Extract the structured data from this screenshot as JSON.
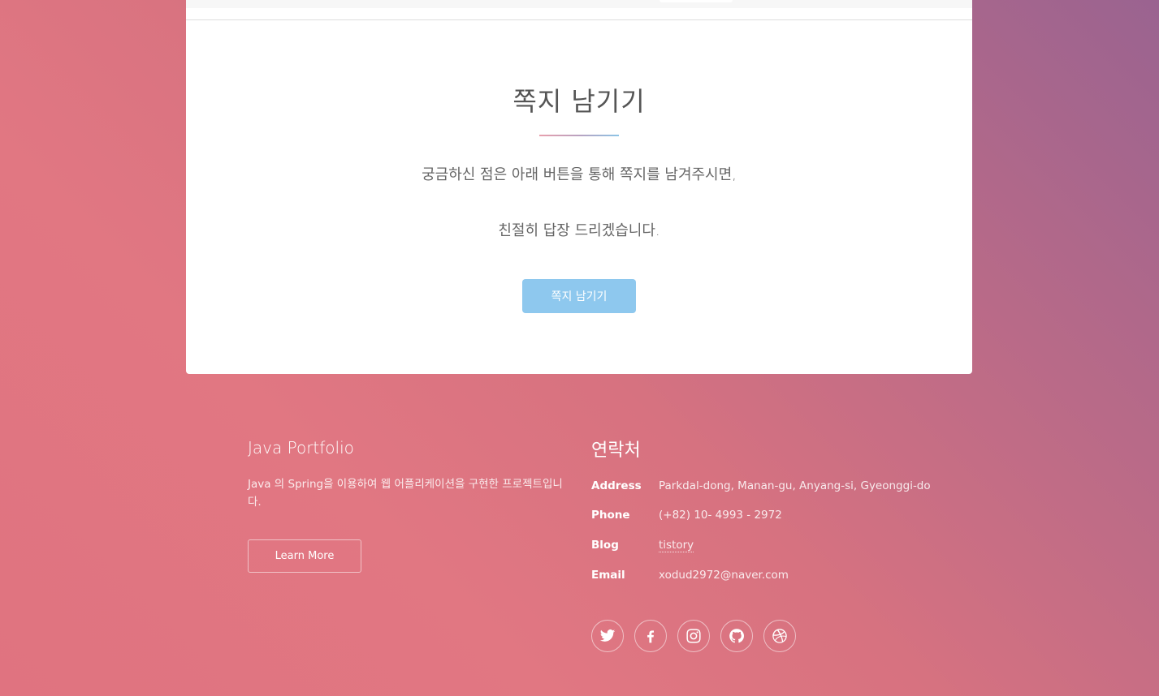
{
  "card": {
    "title": "쪽지 남기기",
    "line1": "궁금하신 점은 아래 버튼을 통해 쪽지를 남겨주시면,",
    "line2": "친절히 답장 드리겠습니다.",
    "button_label": "쪽지 남기기"
  },
  "footer": {
    "about": {
      "title": "Java Portfolio",
      "description": "Java 의 Spring을 이용하여 웹 어플리케이션을 구현한 프로젝트입니다.",
      "button_label": "Learn More"
    },
    "contact": {
      "title": "연락처",
      "rows": [
        {
          "label": "Address",
          "value": "Parkdal-dong, Manan-gu, Anyang-si, Gyeonggi-do"
        },
        {
          "label": "Phone",
          "value": "(+82) 10- 4993 - 2972"
        },
        {
          "label": "Blog",
          "value": "tistory"
        },
        {
          "label": "Email",
          "value": "xodud2972@naver.com"
        }
      ]
    },
    "socials": [
      "twitter-icon",
      "facebook-icon",
      "instagram-icon",
      "github-icon",
      "dribbble-icon"
    ]
  },
  "colors": {
    "button": "#8ec8ee",
    "gradient_start": "#e17782",
    "gradient_end": "#9a6390"
  }
}
